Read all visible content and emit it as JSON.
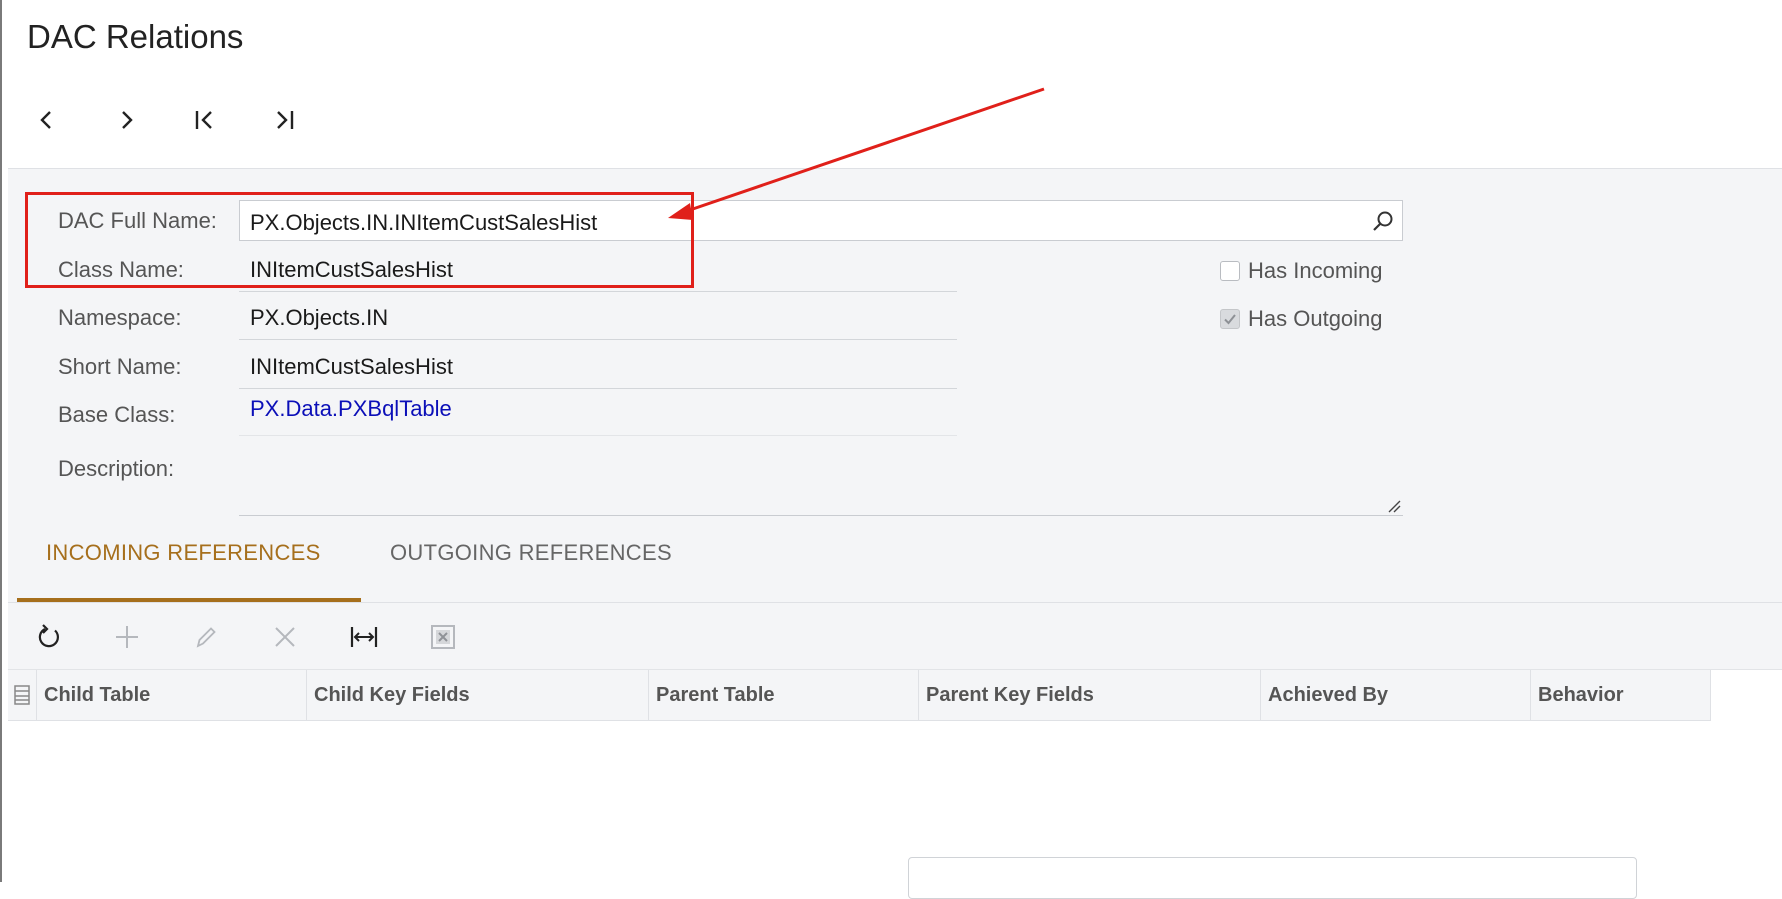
{
  "page": {
    "title": "DAC Relations"
  },
  "form": {
    "dac_full_name": {
      "label": "DAC Full Name:",
      "value": "PX.Objects.IN.INItemCustSalesHist"
    },
    "class_name": {
      "label": "Class Name:",
      "value": "INItemCustSalesHist"
    },
    "namespace": {
      "label": "Namespace:",
      "value": "PX.Objects.IN"
    },
    "short_name": {
      "label": "Short Name:",
      "value": "INItemCustSalesHist"
    },
    "base_class": {
      "label": "Base Class:",
      "value": "PX.Data.PXBqlTable"
    },
    "description": {
      "label": "Description:",
      "value": ""
    },
    "has_incoming": {
      "label": "Has Incoming",
      "checked": false
    },
    "has_outgoing": {
      "label": "Has Outgoing",
      "checked": true
    }
  },
  "tabs": [
    {
      "label": "INCOMING REFERENCES",
      "active": true
    },
    {
      "label": "OUTGOING REFERENCES",
      "active": false
    }
  ],
  "toolbar": {
    "icons": [
      "refresh-icon",
      "add-icon",
      "edit-icon",
      "delete-icon",
      "fit-to-screen-icon",
      "export-excel-icon"
    ]
  },
  "grid": {
    "columns": [
      "Child Table",
      "Child Key Fields",
      "Parent Table",
      "Parent Key Fields",
      "Achieved By",
      "Behavior"
    ],
    "rows": []
  },
  "colors": {
    "accent": "#a66f1c",
    "link": "#0b0fb8",
    "annotation": "#e0201a"
  }
}
